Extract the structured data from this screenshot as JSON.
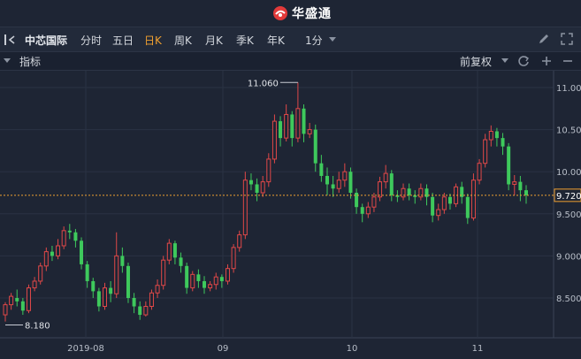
{
  "app": {
    "brand": "华盛通"
  },
  "toolbar": {
    "stock_name": "中芯国际",
    "periods": [
      "分时",
      "五日",
      "日K",
      "周K",
      "月K",
      "季K",
      "年K"
    ],
    "active_period": "日K",
    "minute_select": "1分"
  },
  "indicator_bar": {
    "label": "指标",
    "adjust": "前复权"
  },
  "colors": {
    "up": "#e04848",
    "down": "#3ec95c",
    "background": "#1e2534",
    "current_price": "#f0a030"
  },
  "chart_data": {
    "type": "candlestick",
    "y_ticks": [
      "11.000",
      "10.500",
      "10.000",
      "9.500",
      "9.000",
      "8.500"
    ],
    "ylim": [
      8.0,
      11.05
    ],
    "x_labels": [
      "2019-08",
      "09",
      "10",
      "11"
    ],
    "current_price": "9.720",
    "high_label": "11.060",
    "low_label": "8.180",
    "candles": [
      [
        8.3,
        8.42,
        8.22,
        8.45
      ],
      [
        8.42,
        8.52,
        8.36,
        8.56
      ],
      [
        8.5,
        8.46,
        8.4,
        8.6
      ],
      [
        8.46,
        8.35,
        8.3,
        8.5
      ],
      [
        8.35,
        8.62,
        8.32,
        8.66
      ],
      [
        8.62,
        8.7,
        8.58,
        8.75
      ],
      [
        8.7,
        8.88,
        8.66,
        8.92
      ],
      [
        8.88,
        9.05,
        8.82,
        9.1
      ],
      [
        9.05,
        9.0,
        8.94,
        9.12
      ],
      [
        9.0,
        9.12,
        8.96,
        9.2
      ],
      [
        9.12,
        9.3,
        9.08,
        9.35
      ],
      [
        9.3,
        9.28,
        9.2,
        9.38
      ],
      [
        9.28,
        9.18,
        9.1,
        9.32
      ],
      [
        9.18,
        8.9,
        8.84,
        9.22
      ],
      [
        8.9,
        8.7,
        8.62,
        8.94
      ],
      [
        8.7,
        8.58,
        8.5,
        8.74
      ],
      [
        8.58,
        8.4,
        8.34,
        8.62
      ],
      [
        8.4,
        8.62,
        8.36,
        8.68
      ],
      [
        8.62,
        8.55,
        8.45,
        8.7
      ],
      [
        8.55,
        9.0,
        8.5,
        9.28
      ],
      [
        9.0,
        8.88,
        8.8,
        9.1
      ],
      [
        8.88,
        8.5,
        8.44,
        8.92
      ],
      [
        8.5,
        8.4,
        8.32,
        8.56
      ],
      [
        8.4,
        8.3,
        8.24,
        8.46
      ],
      [
        8.3,
        8.4,
        8.28,
        8.46
      ],
      [
        8.4,
        8.56,
        8.36,
        8.6
      ],
      [
        8.56,
        8.65,
        8.5,
        8.72
      ],
      [
        8.65,
        8.95,
        8.6,
        9.0
      ],
      [
        8.95,
        9.15,
        8.9,
        9.2
      ],
      [
        9.15,
        8.98,
        8.9,
        9.18
      ],
      [
        8.98,
        8.88,
        8.8,
        9.04
      ],
      [
        8.88,
        8.62,
        8.55,
        8.92
      ],
      [
        8.62,
        8.78,
        8.58,
        8.82
      ],
      [
        8.78,
        8.7,
        8.62,
        8.84
      ],
      [
        8.7,
        8.62,
        8.55,
        8.76
      ],
      [
        8.62,
        8.66,
        8.58,
        8.7
      ],
      [
        8.66,
        8.75,
        8.6,
        8.8
      ],
      [
        8.75,
        8.7,
        8.62,
        8.78
      ],
      [
        8.7,
        8.85,
        8.66,
        8.9
      ],
      [
        8.85,
        9.1,
        8.8,
        9.14
      ],
      [
        9.1,
        9.25,
        9.05,
        9.3
      ],
      [
        9.25,
        9.9,
        9.2,
        10.0
      ],
      [
        9.9,
        9.85,
        9.78,
        9.98
      ],
      [
        9.85,
        9.75,
        9.65,
        9.92
      ],
      [
        9.75,
        9.88,
        9.7,
        9.95
      ],
      [
        9.88,
        10.15,
        9.82,
        10.22
      ],
      [
        10.15,
        10.6,
        10.1,
        10.68
      ],
      [
        10.6,
        10.4,
        10.3,
        10.66
      ],
      [
        10.4,
        10.68,
        10.36,
        10.8
      ],
      [
        10.68,
        10.4,
        10.3,
        10.72
      ],
      [
        10.4,
        10.75,
        10.35,
        11.06
      ],
      [
        10.75,
        10.45,
        10.35,
        10.8
      ],
      [
        10.45,
        10.5,
        10.4,
        10.58
      ],
      [
        10.5,
        10.1,
        10.0,
        10.56
      ],
      [
        10.1,
        9.95,
        9.88,
        10.2
      ],
      [
        9.95,
        9.85,
        9.72,
        10.05
      ],
      [
        9.85,
        9.8,
        9.7,
        9.95
      ],
      [
        9.8,
        9.9,
        9.75,
        10.0
      ],
      [
        9.9,
        10.0,
        9.82,
        10.1
      ],
      [
        10.0,
        9.75,
        9.68,
        10.05
      ],
      [
        9.75,
        9.58,
        9.5,
        9.8
      ],
      [
        9.58,
        9.5,
        9.4,
        9.62
      ],
      [
        9.5,
        9.58,
        9.45,
        9.64
      ],
      [
        9.58,
        9.7,
        9.52,
        9.75
      ],
      [
        9.7,
        9.88,
        9.65,
        9.94
      ],
      [
        9.88,
        9.98,
        9.8,
        10.08
      ],
      [
        9.98,
        9.72,
        9.65,
        10.02
      ],
      [
        9.72,
        9.7,
        9.64,
        9.78
      ],
      [
        9.7,
        9.8,
        9.66,
        9.86
      ],
      [
        9.8,
        9.72,
        9.66,
        9.86
      ],
      [
        9.72,
        9.7,
        9.62,
        9.78
      ],
      [
        9.7,
        9.8,
        9.66,
        9.86
      ],
      [
        9.8,
        9.7,
        9.6,
        9.85
      ],
      [
        9.7,
        9.48,
        9.4,
        9.75
      ],
      [
        9.48,
        9.55,
        9.42,
        9.62
      ],
      [
        9.55,
        9.7,
        9.5,
        9.75
      ],
      [
        9.7,
        9.62,
        9.55,
        9.74
      ],
      [
        9.62,
        9.82,
        9.58,
        9.86
      ],
      [
        9.82,
        9.7,
        9.62,
        9.88
      ],
      [
        9.7,
        9.45,
        9.38,
        9.74
      ],
      [
        9.45,
        9.9,
        9.42,
        9.98
      ],
      [
        9.9,
        10.1,
        9.85,
        10.15
      ],
      [
        10.1,
        10.38,
        10.05,
        10.45
      ],
      [
        10.38,
        10.48,
        10.3,
        10.55
      ],
      [
        10.48,
        10.4,
        10.3,
        10.52
      ],
      [
        10.4,
        10.3,
        10.2,
        10.46
      ],
      [
        10.3,
        9.85,
        9.78,
        10.34
      ],
      [
        9.85,
        9.88,
        9.72,
        9.96
      ],
      [
        9.88,
        9.78,
        9.65,
        9.95
      ],
      [
        9.78,
        9.72,
        9.62,
        9.84
      ]
    ]
  }
}
